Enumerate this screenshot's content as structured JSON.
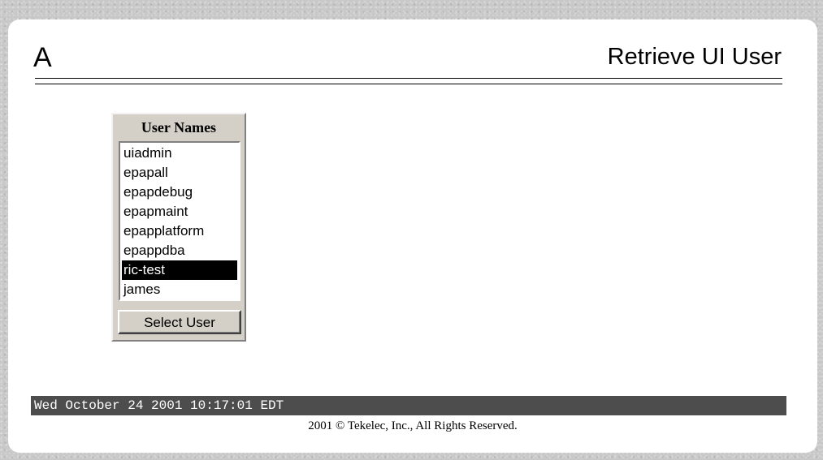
{
  "header": {
    "letter": "A",
    "title": "Retrieve UI User"
  },
  "user_list": {
    "title": "User Names",
    "items": [
      {
        "label": "uiadmin",
        "selected": false
      },
      {
        "label": "epapall",
        "selected": false
      },
      {
        "label": "epapdebug",
        "selected": false
      },
      {
        "label": "epapmaint",
        "selected": false
      },
      {
        "label": "epapplatform",
        "selected": false
      },
      {
        "label": "epappdba",
        "selected": false
      },
      {
        "label": "ric-test",
        "selected": true
      },
      {
        "label": "james",
        "selected": false
      }
    ],
    "button_label": "Select User"
  },
  "status_bar": {
    "datetime": "Wed October 24 2001 10:17:01 EDT"
  },
  "footer": {
    "copyright": "2001 © Tekelec, Inc., All Rights Reserved."
  },
  "colors": {
    "background": "#c8c8c8",
    "panel": "#ffffff",
    "status_bar": "#4d4d4d",
    "selection": "#000000"
  }
}
